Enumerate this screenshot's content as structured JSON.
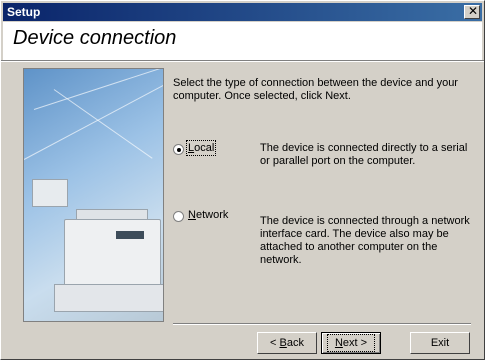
{
  "window": {
    "title": "Setup",
    "close_symbol": "✕"
  },
  "header": {
    "title": "Device connection"
  },
  "intro": "Select the type of connection between the device and your computer. Once selected, click Next.",
  "options": [
    {
      "mnemonic": "L",
      "rest": "ocal",
      "selected": true,
      "description": "The device is connected directly to a serial or parallel port on the computer."
    },
    {
      "mnemonic": "N",
      "rest": "etwork",
      "selected": false,
      "description": "The device is connected through a network interface card. The device also may be attached to another computer on the network."
    }
  ],
  "buttons": {
    "back": {
      "prefix": "< ",
      "mnemonic": "B",
      "rest": "ack"
    },
    "next": {
      "mnemonic": "N",
      "rest": "ext >"
    },
    "exit": {
      "label": "Exit"
    }
  },
  "colors": {
    "titlebar_start": "#0a246a",
    "titlebar_end": "#3a6ea5",
    "dialog_bg": "#d4d0c8"
  },
  "icons": {
    "close": "close-icon",
    "hero": "printer-illustration"
  }
}
